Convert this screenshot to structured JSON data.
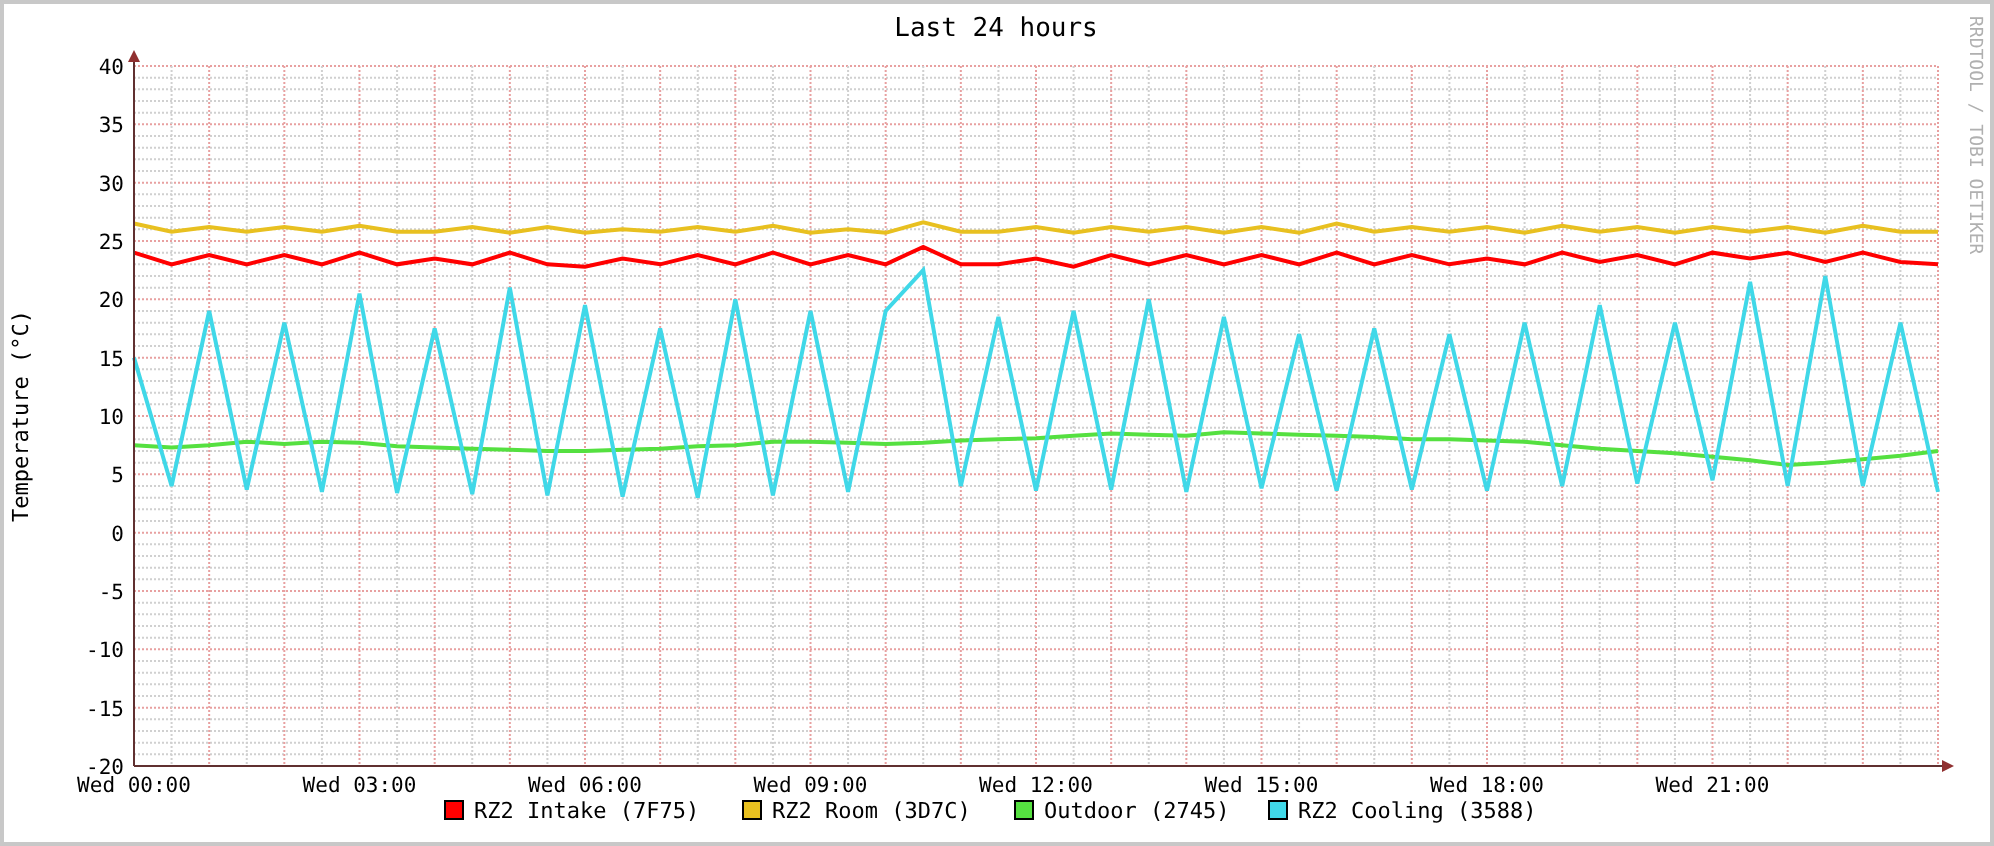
{
  "graph": {
    "credit": "RRDTOOL / TOBI OETIKER",
    "chart_data": {
      "type": "line",
      "title": "Last 24 hours",
      "ylabel": "Temperature (°C)",
      "categories": [
        "Wed 00:00",
        null,
        null,
        null,
        null,
        null,
        "Wed 03:00",
        null,
        null,
        null,
        null,
        null,
        "Wed 06:00",
        null,
        null,
        null,
        null,
        null,
        "Wed 09:00",
        null,
        null,
        null,
        null,
        null,
        "Wed 12:00",
        null,
        null,
        null,
        null,
        null,
        "Wed 15:00",
        null,
        null,
        null,
        null,
        null,
        "Wed 18:00",
        null,
        null,
        null,
        null,
        null,
        "Wed 21:00",
        null,
        null,
        null,
        null,
        null,
        null
      ],
      "ylim": [
        -20,
        40
      ],
      "grid": true,
      "legend": "bottom",
      "yticks": [
        -20,
        -15,
        -10,
        -5,
        0,
        5,
        10,
        15,
        20,
        25,
        30,
        35,
        40
      ],
      "series": [
        {
          "name": "RZ2 Intake (7F75)",
          "color": "#ff0000",
          "values": [
            24,
            23,
            23.8,
            23,
            23.8,
            23,
            24,
            23,
            23.5,
            23,
            24,
            23,
            22.8,
            23.5,
            23,
            23.8,
            23,
            24,
            23,
            23.8,
            23,
            24.5,
            23,
            23,
            23.5,
            22.8,
            23.8,
            23,
            23.8,
            23,
            23.8,
            23,
            24,
            23,
            23.8,
            23,
            23.5,
            23,
            24,
            23.2,
            23.8,
            23,
            24,
            23.5,
            24,
            23.2,
            24,
            23.2,
            23
          ]
        },
        {
          "name": "RZ2 Room (3D7C)",
          "color": "#e8c020",
          "values": [
            26.5,
            25.8,
            26.2,
            25.8,
            26.2,
            25.8,
            26.3,
            25.8,
            25.8,
            26.2,
            25.7,
            26.2,
            25.7,
            26,
            25.8,
            26.2,
            25.8,
            26.3,
            25.7,
            26,
            25.7,
            26.6,
            25.8,
            25.8,
            26.2,
            25.7,
            26.2,
            25.8,
            26.2,
            25.7,
            26.2,
            25.7,
            26.5,
            25.8,
            26.2,
            25.8,
            26.2,
            25.7,
            26.3,
            25.8,
            26.2,
            25.7,
            26.2,
            25.8,
            26.2,
            25.7,
            26.3,
            25.8,
            25.8
          ]
        },
        {
          "name": "Outdoor (2745)",
          "color": "#55e040",
          "values": [
            7.5,
            7.3,
            7.5,
            7.8,
            7.6,
            7.8,
            7.7,
            7.4,
            7.3,
            7.2,
            7.1,
            7,
            7,
            7.1,
            7.2,
            7.4,
            7.5,
            7.8,
            7.8,
            7.7,
            7.6,
            7.7,
            7.9,
            8,
            8.1,
            8.3,
            8.5,
            8.4,
            8.3,
            8.6,
            8.5,
            8.4,
            8.3,
            8.2,
            8,
            8,
            7.9,
            7.8,
            7.5,
            7.2,
            7,
            6.8,
            6.5,
            6.2,
            5.8,
            6,
            6.3,
            6.6,
            7
          ]
        },
        {
          "name": "RZ2 Cooling (3588)",
          "color": "#40d8e8",
          "values": [
            15,
            4,
            19,
            3.7,
            18,
            3.5,
            20.5,
            3.4,
            17.5,
            3.3,
            21,
            3.2,
            19.5,
            3.1,
            17.5,
            3,
            20,
            3.2,
            19,
            3.5,
            19,
            22.5,
            4,
            18.5,
            3.6,
            19,
            3.7,
            20,
            3.5,
            18.5,
            3.8,
            17,
            3.6,
            17.5,
            3.7,
            17,
            3.6,
            18,
            4,
            19.5,
            4.2,
            18,
            4.5,
            21.5,
            4,
            22,
            4,
            18,
            3.5
          ]
        }
      ]
    }
  }
}
